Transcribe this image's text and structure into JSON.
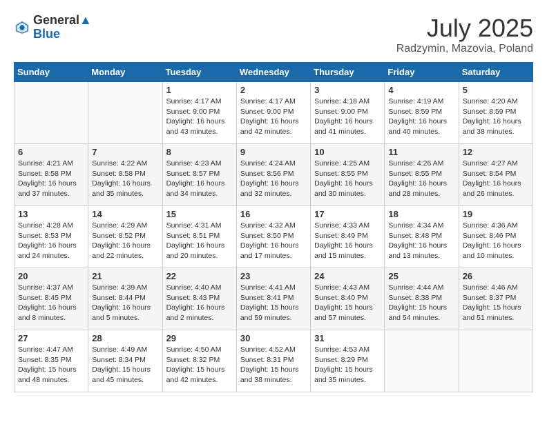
{
  "header": {
    "logo_general": "General",
    "logo_blue": "Blue",
    "month_year": "July 2025",
    "location": "Radzymin, Mazovia, Poland"
  },
  "days_of_week": [
    "Sunday",
    "Monday",
    "Tuesday",
    "Wednesday",
    "Thursday",
    "Friday",
    "Saturday"
  ],
  "weeks": [
    [
      {
        "num": "",
        "info": "",
        "empty": true
      },
      {
        "num": "",
        "info": "",
        "empty": true
      },
      {
        "num": "1",
        "info": "Sunrise: 4:17 AM\nSunset: 9:00 PM\nDaylight: 16 hours\nand 43 minutes."
      },
      {
        "num": "2",
        "info": "Sunrise: 4:17 AM\nSunset: 9:00 PM\nDaylight: 16 hours\nand 42 minutes."
      },
      {
        "num": "3",
        "info": "Sunrise: 4:18 AM\nSunset: 9:00 PM\nDaylight: 16 hours\nand 41 minutes."
      },
      {
        "num": "4",
        "info": "Sunrise: 4:19 AM\nSunset: 8:59 PM\nDaylight: 16 hours\nand 40 minutes."
      },
      {
        "num": "5",
        "info": "Sunrise: 4:20 AM\nSunset: 8:59 PM\nDaylight: 16 hours\nand 38 minutes."
      }
    ],
    [
      {
        "num": "6",
        "info": "Sunrise: 4:21 AM\nSunset: 8:58 PM\nDaylight: 16 hours\nand 37 minutes."
      },
      {
        "num": "7",
        "info": "Sunrise: 4:22 AM\nSunset: 8:58 PM\nDaylight: 16 hours\nand 35 minutes."
      },
      {
        "num": "8",
        "info": "Sunrise: 4:23 AM\nSunset: 8:57 PM\nDaylight: 16 hours\nand 34 minutes."
      },
      {
        "num": "9",
        "info": "Sunrise: 4:24 AM\nSunset: 8:56 PM\nDaylight: 16 hours\nand 32 minutes."
      },
      {
        "num": "10",
        "info": "Sunrise: 4:25 AM\nSunset: 8:55 PM\nDaylight: 16 hours\nand 30 minutes."
      },
      {
        "num": "11",
        "info": "Sunrise: 4:26 AM\nSunset: 8:55 PM\nDaylight: 16 hours\nand 28 minutes."
      },
      {
        "num": "12",
        "info": "Sunrise: 4:27 AM\nSunset: 8:54 PM\nDaylight: 16 hours\nand 26 minutes."
      }
    ],
    [
      {
        "num": "13",
        "info": "Sunrise: 4:28 AM\nSunset: 8:53 PM\nDaylight: 16 hours\nand 24 minutes."
      },
      {
        "num": "14",
        "info": "Sunrise: 4:29 AM\nSunset: 8:52 PM\nDaylight: 16 hours\nand 22 minutes."
      },
      {
        "num": "15",
        "info": "Sunrise: 4:31 AM\nSunset: 8:51 PM\nDaylight: 16 hours\nand 20 minutes."
      },
      {
        "num": "16",
        "info": "Sunrise: 4:32 AM\nSunset: 8:50 PM\nDaylight: 16 hours\nand 17 minutes."
      },
      {
        "num": "17",
        "info": "Sunrise: 4:33 AM\nSunset: 8:49 PM\nDaylight: 16 hours\nand 15 minutes."
      },
      {
        "num": "18",
        "info": "Sunrise: 4:34 AM\nSunset: 8:48 PM\nDaylight: 16 hours\nand 13 minutes."
      },
      {
        "num": "19",
        "info": "Sunrise: 4:36 AM\nSunset: 8:46 PM\nDaylight: 16 hours\nand 10 minutes."
      }
    ],
    [
      {
        "num": "20",
        "info": "Sunrise: 4:37 AM\nSunset: 8:45 PM\nDaylight: 16 hours\nand 8 minutes."
      },
      {
        "num": "21",
        "info": "Sunrise: 4:39 AM\nSunset: 8:44 PM\nDaylight: 16 hours\nand 5 minutes."
      },
      {
        "num": "22",
        "info": "Sunrise: 4:40 AM\nSunset: 8:43 PM\nDaylight: 16 hours\nand 2 minutes."
      },
      {
        "num": "23",
        "info": "Sunrise: 4:41 AM\nSunset: 8:41 PM\nDaylight: 15 hours\nand 59 minutes."
      },
      {
        "num": "24",
        "info": "Sunrise: 4:43 AM\nSunset: 8:40 PM\nDaylight: 15 hours\nand 57 minutes."
      },
      {
        "num": "25",
        "info": "Sunrise: 4:44 AM\nSunset: 8:38 PM\nDaylight: 15 hours\nand 54 minutes."
      },
      {
        "num": "26",
        "info": "Sunrise: 4:46 AM\nSunset: 8:37 PM\nDaylight: 15 hours\nand 51 minutes."
      }
    ],
    [
      {
        "num": "27",
        "info": "Sunrise: 4:47 AM\nSunset: 8:35 PM\nDaylight: 15 hours\nand 48 minutes."
      },
      {
        "num": "28",
        "info": "Sunrise: 4:49 AM\nSunset: 8:34 PM\nDaylight: 15 hours\nand 45 minutes."
      },
      {
        "num": "29",
        "info": "Sunrise: 4:50 AM\nSunset: 8:32 PM\nDaylight: 15 hours\nand 42 minutes."
      },
      {
        "num": "30",
        "info": "Sunrise: 4:52 AM\nSunset: 8:31 PM\nDaylight: 15 hours\nand 38 minutes."
      },
      {
        "num": "31",
        "info": "Sunrise: 4:53 AM\nSunset: 8:29 PM\nDaylight: 15 hours\nand 35 minutes."
      },
      {
        "num": "",
        "info": "",
        "empty": true
      },
      {
        "num": "",
        "info": "",
        "empty": true
      }
    ]
  ]
}
